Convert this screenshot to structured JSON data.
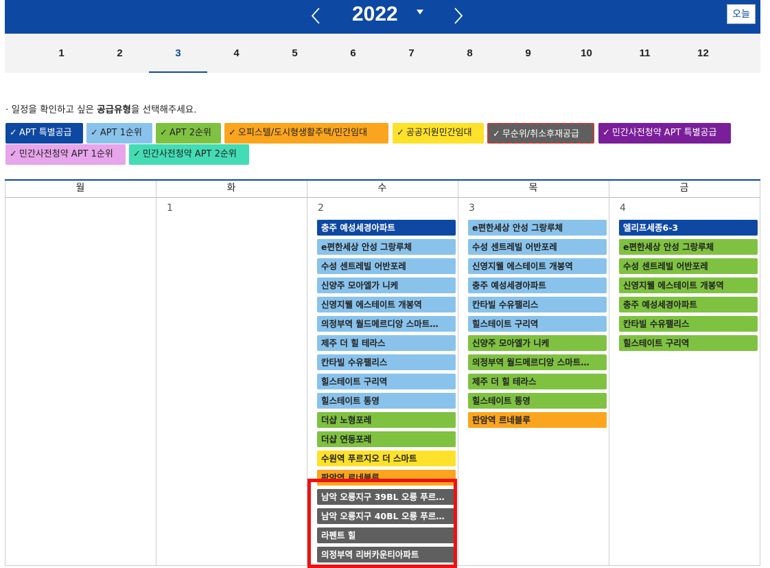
{
  "header": {
    "year": "2022",
    "today_label": "오늘",
    "colors": {
      "bar": "#0d48a3"
    }
  },
  "months": [
    "1",
    "2",
    "3",
    "4",
    "5",
    "6",
    "7",
    "8",
    "9",
    "10",
    "11",
    "12"
  ],
  "active_month": "3",
  "guide": {
    "prefix": "· 일정을 확인하고 싶은 ",
    "bold": "공급유형",
    "suffix": "을 선택해주세요."
  },
  "filters": [
    {
      "label": "APT 특별공급",
      "color": "#0d48a3"
    },
    {
      "label": "APT 1순위",
      "color": "#89c3ec"
    },
    {
      "label": "APT 2순위",
      "color": "#7fc241"
    },
    {
      "label": "오피스텔/도시형생활주택/민간임대",
      "color": "#fba51e"
    },
    {
      "label": "공공지원민간임대",
      "color": "#fde12a"
    },
    {
      "label": "무순위/취소후재공급",
      "color": "#5f5f5f"
    },
    {
      "label": "민간사전청약 APT 특별공급",
      "color": "#7a1e99"
    },
    {
      "label": "민간사전청약 APT 1순위",
      "color": "#e7a5ec"
    },
    {
      "label": "민간사전청약 APT 2순위",
      "color": "#44dcb5"
    }
  ],
  "calendar": {
    "weekdays": [
      "월",
      "화",
      "수",
      "목",
      "금"
    ],
    "days": [
      {
        "num": "",
        "events": []
      },
      {
        "num": "1",
        "events": []
      },
      {
        "num": "2",
        "events": [
          {
            "label": "충주 예성세경아파트",
            "type": "special"
          },
          {
            "label": "e편한세상 안성 그랑루체",
            "type": "first"
          },
          {
            "label": "수성 센트레빌 어반포레",
            "type": "first"
          },
          {
            "label": "신양주 모아엘가 니케",
            "type": "first"
          },
          {
            "label": "신영지웰 에스테이트 개봉역",
            "type": "first"
          },
          {
            "label": "의정부역 월드메르디앙 스마트…",
            "type": "first"
          },
          {
            "label": "제주 더 힐 테라스",
            "type": "first"
          },
          {
            "label": "칸타빌 수유팰리스",
            "type": "first"
          },
          {
            "label": "힐스테이트 구리역",
            "type": "first"
          },
          {
            "label": "힐스테이트 통영",
            "type": "first"
          },
          {
            "label": "더샵 노형포레",
            "type": "second"
          },
          {
            "label": "더샵 연동포레",
            "type": "second"
          },
          {
            "label": "수원역 푸르지오 더 스마트",
            "type": "public"
          },
          {
            "label": "판암역 르네블루",
            "type": "officetel"
          },
          {
            "label": "남악 오룡지구 39BL 오룡 푸르…",
            "type": "unranked"
          },
          {
            "label": "남악 오룡지구 40BL 오룡 푸르…",
            "type": "unranked"
          },
          {
            "label": "라펜트 힐",
            "type": "unranked"
          },
          {
            "label": "의정부역 리버카운티아파트",
            "type": "unranked"
          }
        ]
      },
      {
        "num": "3",
        "events": [
          {
            "label": "e편한세상 안성 그랑루체",
            "type": "first"
          },
          {
            "label": "수성 센트레빌 어반포레",
            "type": "first"
          },
          {
            "label": "신영지웰 에스테이트 개봉역",
            "type": "first"
          },
          {
            "label": "충주 예성세경아파트",
            "type": "first"
          },
          {
            "label": "칸타빌 수유팰리스",
            "type": "first"
          },
          {
            "label": "힐스테이트 구리역",
            "type": "first"
          },
          {
            "label": "신양주 모아엘가 니케",
            "type": "second"
          },
          {
            "label": "의정부역 월드메르디앙 스마트…",
            "type": "second"
          },
          {
            "label": "제주 더 힐 테라스",
            "type": "second"
          },
          {
            "label": "힐스테이트 통영",
            "type": "second"
          },
          {
            "label": "판암역 르네블루",
            "type": "officetel"
          }
        ]
      },
      {
        "num": "4",
        "events": [
          {
            "label": "엘리프세종6-3",
            "type": "special"
          },
          {
            "label": "e편한세상 안성 그랑루체",
            "type": "second"
          },
          {
            "label": "수성 센트레빌 어반포레",
            "type": "second"
          },
          {
            "label": "신영지웰 에스테이트 개봉역",
            "type": "second"
          },
          {
            "label": "충주 예성세경아파트",
            "type": "second"
          },
          {
            "label": "칸타빌 수유팰리스",
            "type": "second"
          },
          {
            "label": "힐스테이트 구리역",
            "type": "second"
          }
        ]
      }
    ]
  },
  "event_colors": {
    "special": "#0d48a3",
    "first": "#89c3ec",
    "second": "#7fc241",
    "public": "#fde12a",
    "officetel": "#fba51e",
    "unranked": "#5f5f5f"
  }
}
